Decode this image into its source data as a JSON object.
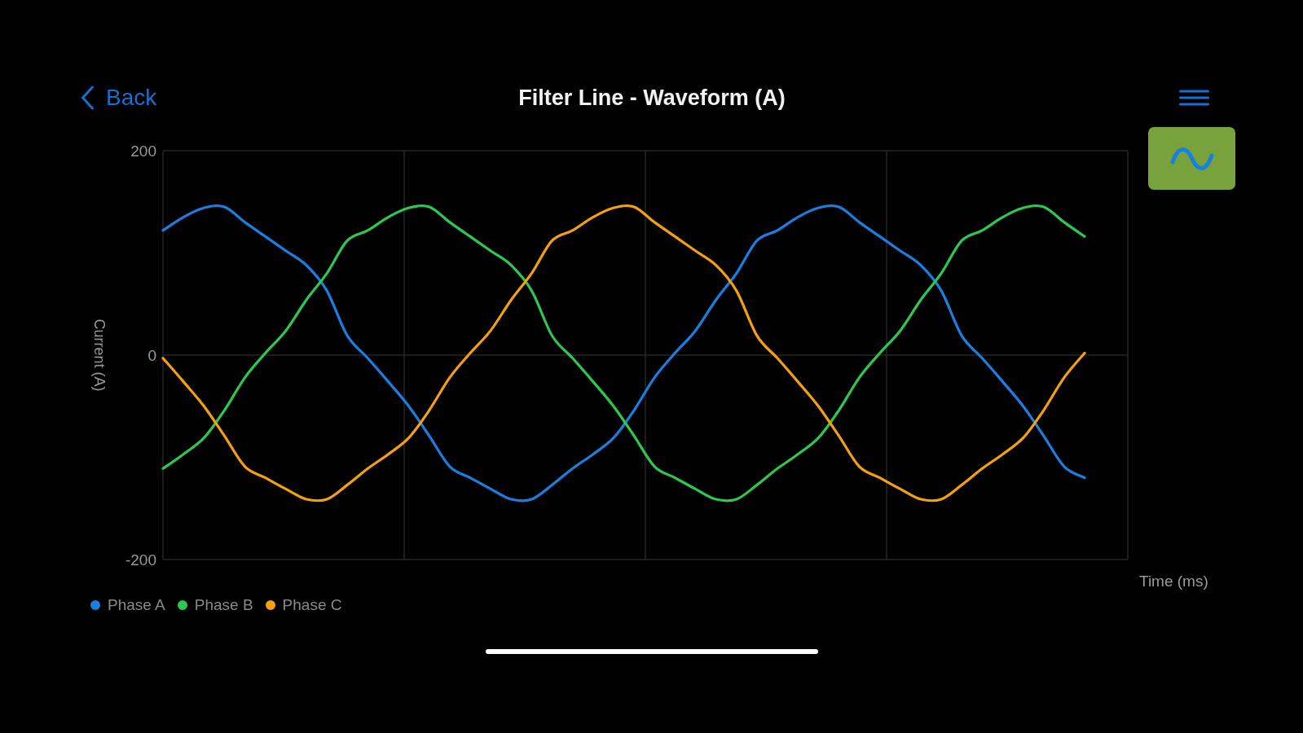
{
  "nav": {
    "back_label": "Back",
    "title": "Filter Line - Waveform (A)"
  },
  "chart_data": {
    "type": "line",
    "xlabel": "Time (ms)",
    "ylabel": "Current (A)",
    "ylim": [
      -200,
      200
    ],
    "yticks": [
      -200,
      0,
      200
    ],
    "legend": "bottom",
    "series": [
      {
        "name": "Phase A",
        "color": "#1a7fe0",
        "values": [
          122,
          135,
          144,
          145,
          130,
          116,
          102,
          88,
          63,
          19,
          -3,
          -26,
          -50,
          -79,
          -109,
          -120,
          -131,
          -141,
          -141,
          -127,
          -111,
          -97,
          -81,
          -54,
          -22,
          2,
          24,
          54,
          80,
          112,
          122,
          135,
          144,
          145,
          130,
          116,
          102,
          88,
          63,
          19,
          -3,
          -26,
          -50,
          -79,
          -109,
          -120
        ]
      },
      {
        "name": "Phase B",
        "color": "#2ec750",
        "values": [
          -111,
          -97,
          -81,
          -54,
          -22,
          2,
          24,
          54,
          80,
          112,
          122,
          135,
          144,
          145,
          130,
          116,
          102,
          88,
          63,
          19,
          -3,
          -26,
          -50,
          -79,
          -109,
          -120,
          -131,
          -141,
          -141,
          -127,
          -111,
          -97,
          -81,
          -54,
          -22,
          2,
          24,
          54,
          80,
          112,
          122,
          135,
          144,
          145,
          130,
          116
        ]
      },
      {
        "name": "Phase C",
        "color": "#f5a10f",
        "values": [
          -3,
          -26,
          -50,
          -79,
          -109,
          -120,
          -131,
          -141,
          -141,
          -127,
          -111,
          -97,
          -81,
          -54,
          -22,
          2,
          24,
          54,
          80,
          112,
          122,
          135,
          144,
          145,
          130,
          116,
          102,
          88,
          63,
          19,
          -3,
          -26,
          -50,
          -79,
          -109,
          -120,
          -131,
          -141,
          -141,
          -127,
          -111,
          -97,
          -81,
          -54,
          -22,
          2
        ]
      }
    ]
  }
}
